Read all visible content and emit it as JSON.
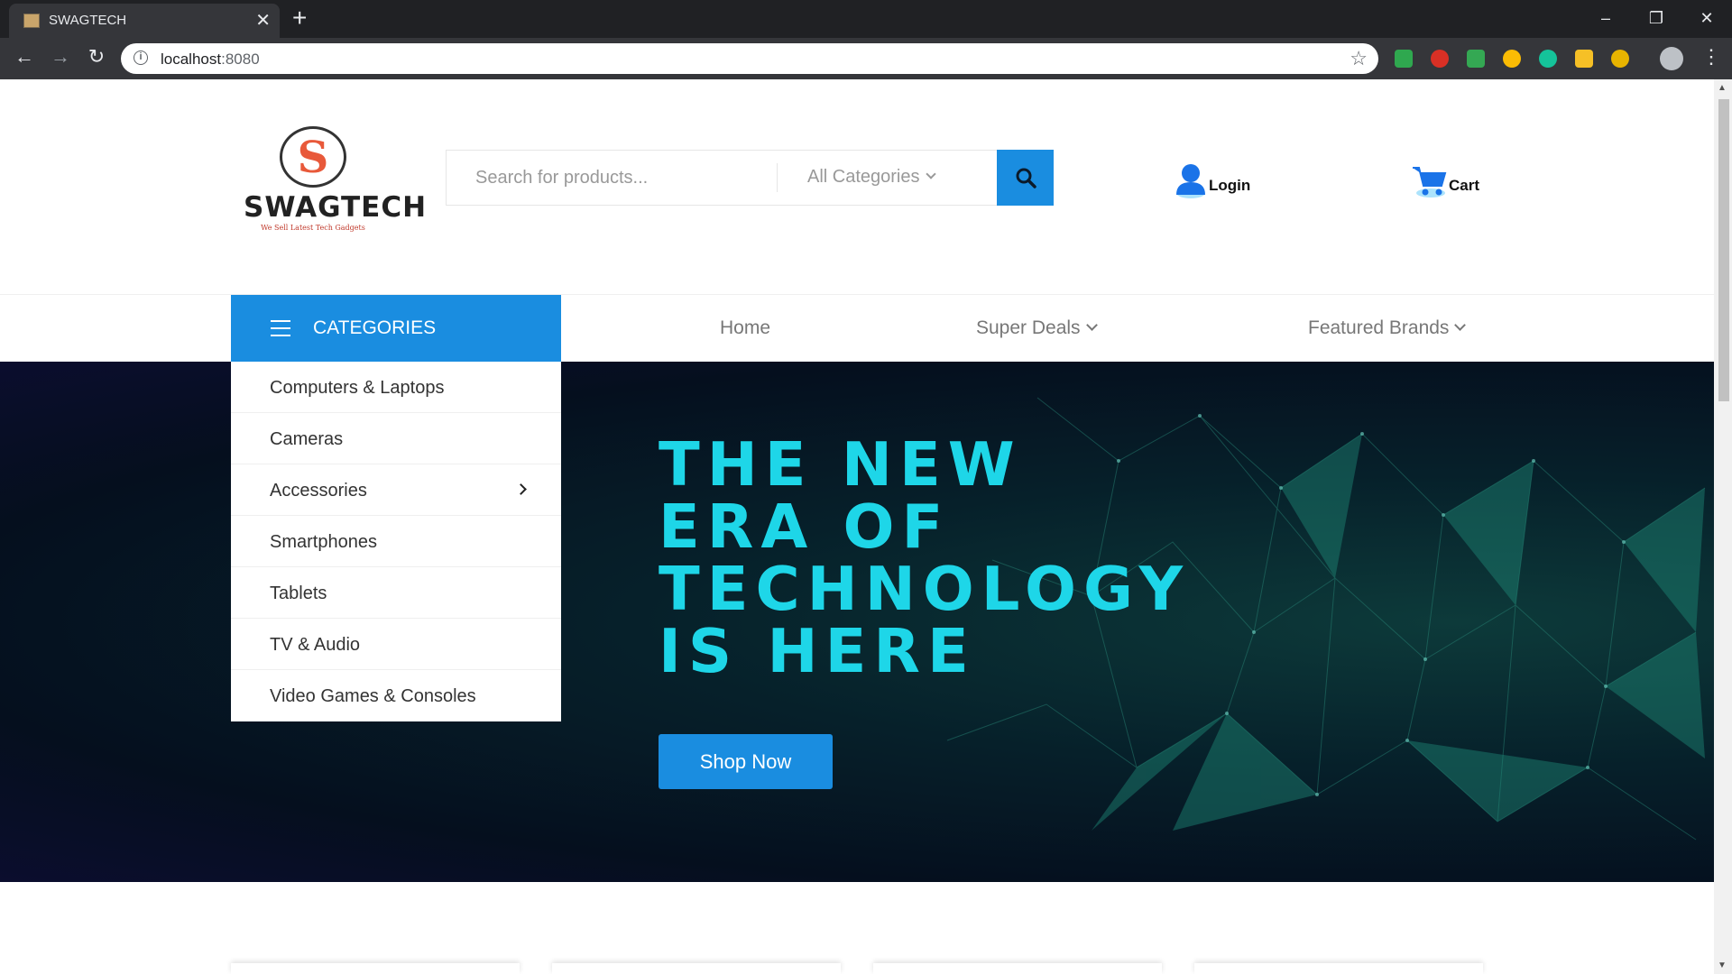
{
  "browser": {
    "tab_title": "SWAGTECH",
    "tab_close": "✕",
    "new_tab": "+",
    "url_host": "localhost",
    "url_port": ":8080",
    "window_buttons": [
      "–",
      "❐",
      "✕"
    ],
    "nav_icons": [
      "back-icon",
      "forward-icon",
      "reload-icon"
    ],
    "extensions": [
      {
        "name": "shield-extension-icon",
        "color": "#2fa84f"
      },
      {
        "name": "yab-extension-icon",
        "color": "#d93025"
      },
      {
        "name": "mail-extension-icon",
        "color": "#34a853"
      },
      {
        "name": "globe-extension-icon",
        "color": "#fbbc04"
      },
      {
        "name": "grammarly-extension-icon",
        "color": "#15c39a"
      },
      {
        "name": "star-extension-icon",
        "color": "#f6c026"
      },
      {
        "name": "coin-extension-icon",
        "color": "#e8b400"
      }
    ]
  },
  "header": {
    "logo_letter": "S",
    "logo_name": "SWAGTECH",
    "logo_tagline": "We Sell Latest Tech Gadgets",
    "search": {
      "placeholder": "Search for products...",
      "category": "All Categories"
    },
    "login_label": "Login",
    "cart_label": "Cart"
  },
  "nav": {
    "categories_title": "CATEGORIES",
    "links": [
      "Home",
      "Super Deals",
      "Featured Brands"
    ]
  },
  "categories": [
    {
      "label": "Computers & Laptops",
      "has_submenu": false
    },
    {
      "label": "Cameras",
      "has_submenu": false
    },
    {
      "label": "Accessories",
      "has_submenu": true
    },
    {
      "label": "Smartphones",
      "has_submenu": false
    },
    {
      "label": "Tablets",
      "has_submenu": false
    },
    {
      "label": "TV & Audio",
      "has_submenu": false
    },
    {
      "label": "Video Games & Consoles",
      "has_submenu": false
    }
  ],
  "hero": {
    "title_lines": [
      "THE NEW",
      "ERA OF",
      "TECHNOLOGY",
      "IS HERE"
    ],
    "cta": "Shop Now"
  },
  "colors": {
    "accent": "#1a8de0",
    "hero_text": "#1ed6e8",
    "hero_bg": "#06202a"
  }
}
